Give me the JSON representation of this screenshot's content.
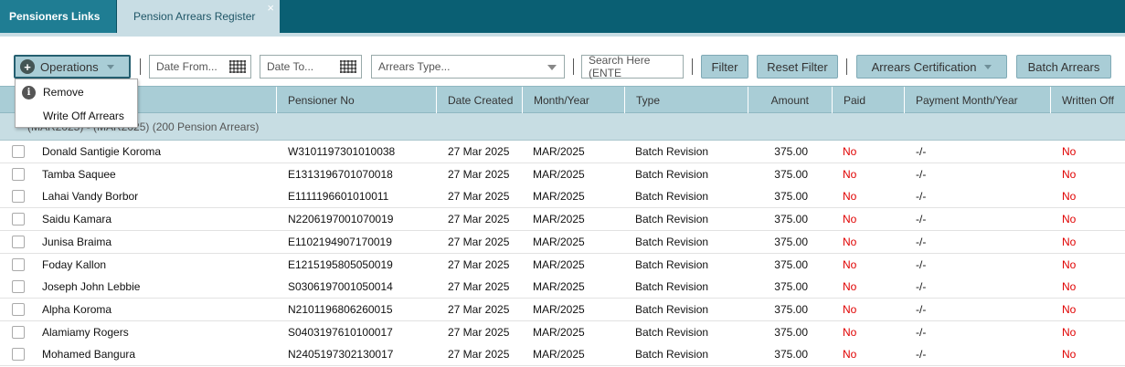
{
  "tabs": [
    {
      "label": "Pensioners Links"
    },
    {
      "label": "Pension Arrears Register",
      "close": "×"
    }
  ],
  "toolbar": {
    "operations_label": "Operations",
    "date_from_placeholder": "Date From...",
    "date_to_placeholder": "Date To...",
    "arrears_type_placeholder": "Arrears Type...",
    "search_placeholder": "Search Here (ENTE",
    "filter_label": "Filter",
    "reset_filter_label": "Reset Filter",
    "arrears_certification_label": "Arrears Certification",
    "batch_arrears_label": "Batch Arrears"
  },
  "operations_menu": {
    "remove_label": "Remove",
    "write_off_label": "Write Off Arrears"
  },
  "columns": [
    "Pensioner No",
    "Date Created",
    "Month/Year",
    "Type",
    "Amount",
    "Paid",
    "Payment Month/Year",
    "Written Off"
  ],
  "group": {
    "label": "(MAR2025) - (MAR2025) (200 Pension Arrears)"
  },
  "rows": [
    {
      "name": "Donald Santigie Koroma",
      "pensioner_no": "W3101197301010038",
      "date_created": "27 Mar 2025",
      "month_year": "MAR/2025",
      "type": "Batch Revision",
      "amount": "375.00",
      "paid": "No",
      "payment_month_year": "-/-",
      "written_off": "No"
    },
    {
      "name": "Tamba Saquee",
      "pensioner_no": "E1313196701070018",
      "date_created": "27 Mar 2025",
      "month_year": "MAR/2025",
      "type": "Batch Revision",
      "amount": "375.00",
      "paid": "No",
      "payment_month_year": "-/-",
      "written_off": "No"
    },
    {
      "name": "Lahai Vandy Borbor",
      "pensioner_no": "E1111196601010011",
      "date_created": "27 Mar 2025",
      "month_year": "MAR/2025",
      "type": "Batch Revision",
      "amount": "375.00",
      "paid": "No",
      "payment_month_year": "-/-",
      "written_off": "No"
    },
    {
      "name": "Saidu Kamara",
      "pensioner_no": "N2206197001070019",
      "date_created": "27 Mar 2025",
      "month_year": "MAR/2025",
      "type": "Batch Revision",
      "amount": "375.00",
      "paid": "No",
      "payment_month_year": "-/-",
      "written_off": "No"
    },
    {
      "name": "Junisa Braima",
      "pensioner_no": "E1102194907170019",
      "date_created": "27 Mar 2025",
      "month_year": "MAR/2025",
      "type": "Batch Revision",
      "amount": "375.00",
      "paid": "No",
      "payment_month_year": "-/-",
      "written_off": "No"
    },
    {
      "name": "Foday Kallon",
      "pensioner_no": "E1215195805050019",
      "date_created": "27 Mar 2025",
      "month_year": "MAR/2025",
      "type": "Batch Revision",
      "amount": "375.00",
      "paid": "No",
      "payment_month_year": "-/-",
      "written_off": "No"
    },
    {
      "name": "Joseph John Lebbie",
      "pensioner_no": "S0306197001050014",
      "date_created": "27 Mar 2025",
      "month_year": "MAR/2025",
      "type": "Batch Revision",
      "amount": "375.00",
      "paid": "No",
      "payment_month_year": "-/-",
      "written_off": "No"
    },
    {
      "name": "Alpha Koroma",
      "pensioner_no": "N2101196806260015",
      "date_created": "27 Mar 2025",
      "month_year": "MAR/2025",
      "type": "Batch Revision",
      "amount": "375.00",
      "paid": "No",
      "payment_month_year": "-/-",
      "written_off": "No"
    },
    {
      "name": "Alamiamy Rogers",
      "pensioner_no": "S0403197610100017",
      "date_created": "27 Mar 2025",
      "month_year": "MAR/2025",
      "type": "Batch Revision",
      "amount": "375.00",
      "paid": "No",
      "payment_month_year": "-/-",
      "written_off": "No"
    },
    {
      "name": "Mohamed Bangura",
      "pensioner_no": "N2405197302130017",
      "date_created": "27 Mar 2025",
      "month_year": "MAR/2025",
      "type": "Batch Revision",
      "amount": "375.00",
      "paid": "No",
      "payment_month_year": "-/-",
      "written_off": "No"
    }
  ],
  "colors": {
    "paid_no": "#e00000",
    "header_bg": "#a9cdd6",
    "tabbar_bg": "#0a5f73"
  }
}
